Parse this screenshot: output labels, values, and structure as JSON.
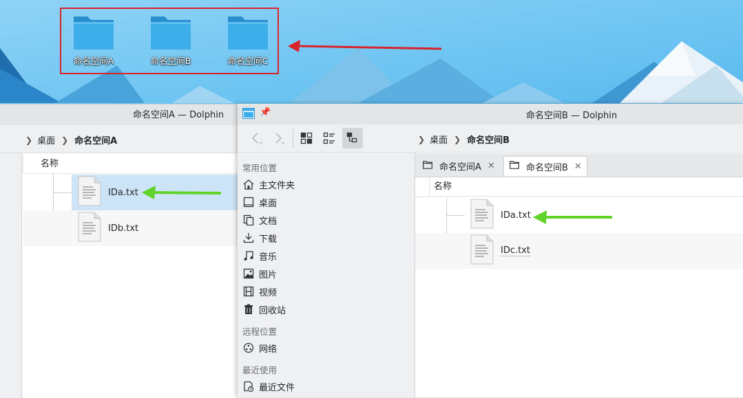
{
  "desktop": {
    "icons": [
      {
        "label": "命名空间A"
      },
      {
        "label": "命名空间B"
      },
      {
        "label": "命名空间C"
      }
    ]
  },
  "window_a": {
    "title": "命名空间A — Dolphin",
    "breadcrumb": {
      "root": "桌面",
      "current": "命名空间A"
    },
    "column_name": "名称",
    "files": [
      {
        "name": "IDa.txt"
      },
      {
        "name": "IDb.txt"
      }
    ]
  },
  "window_b": {
    "title": "命名空间B — Dolphin",
    "breadcrumb": {
      "root": "桌面",
      "current": "命名空间B"
    },
    "places": {
      "section_common": "常用位置",
      "common": [
        {
          "label": "主文件夹",
          "icon": "home-icon"
        },
        {
          "label": "桌面",
          "icon": "desktop-icon"
        },
        {
          "label": "文档",
          "icon": "documents-icon"
        },
        {
          "label": "下载",
          "icon": "download-icon"
        },
        {
          "label": "音乐",
          "icon": "music-icon"
        },
        {
          "label": "图片",
          "icon": "pictures-icon"
        },
        {
          "label": "视频",
          "icon": "video-icon"
        },
        {
          "label": "回收站",
          "icon": "trash-icon"
        }
      ],
      "section_remote": "远程位置",
      "remote": [
        {
          "label": "网络",
          "icon": "network-icon"
        }
      ],
      "section_recent": "最近使用",
      "recent": [
        {
          "label": "最近文件",
          "icon": "recent-files-icon"
        }
      ]
    },
    "tabs": [
      {
        "label": "命名空间A",
        "selected": false
      },
      {
        "label": "命名空间B",
        "selected": true
      }
    ],
    "column_name": "名称",
    "files": [
      {
        "name": "IDa.txt"
      },
      {
        "name": "IDc.txt"
      }
    ]
  },
  "colors": {
    "selection": "#cde4f7",
    "annotation_red": "#d9232b",
    "annotation_green": "#5fd327",
    "folder_blue": "#3daee9"
  }
}
